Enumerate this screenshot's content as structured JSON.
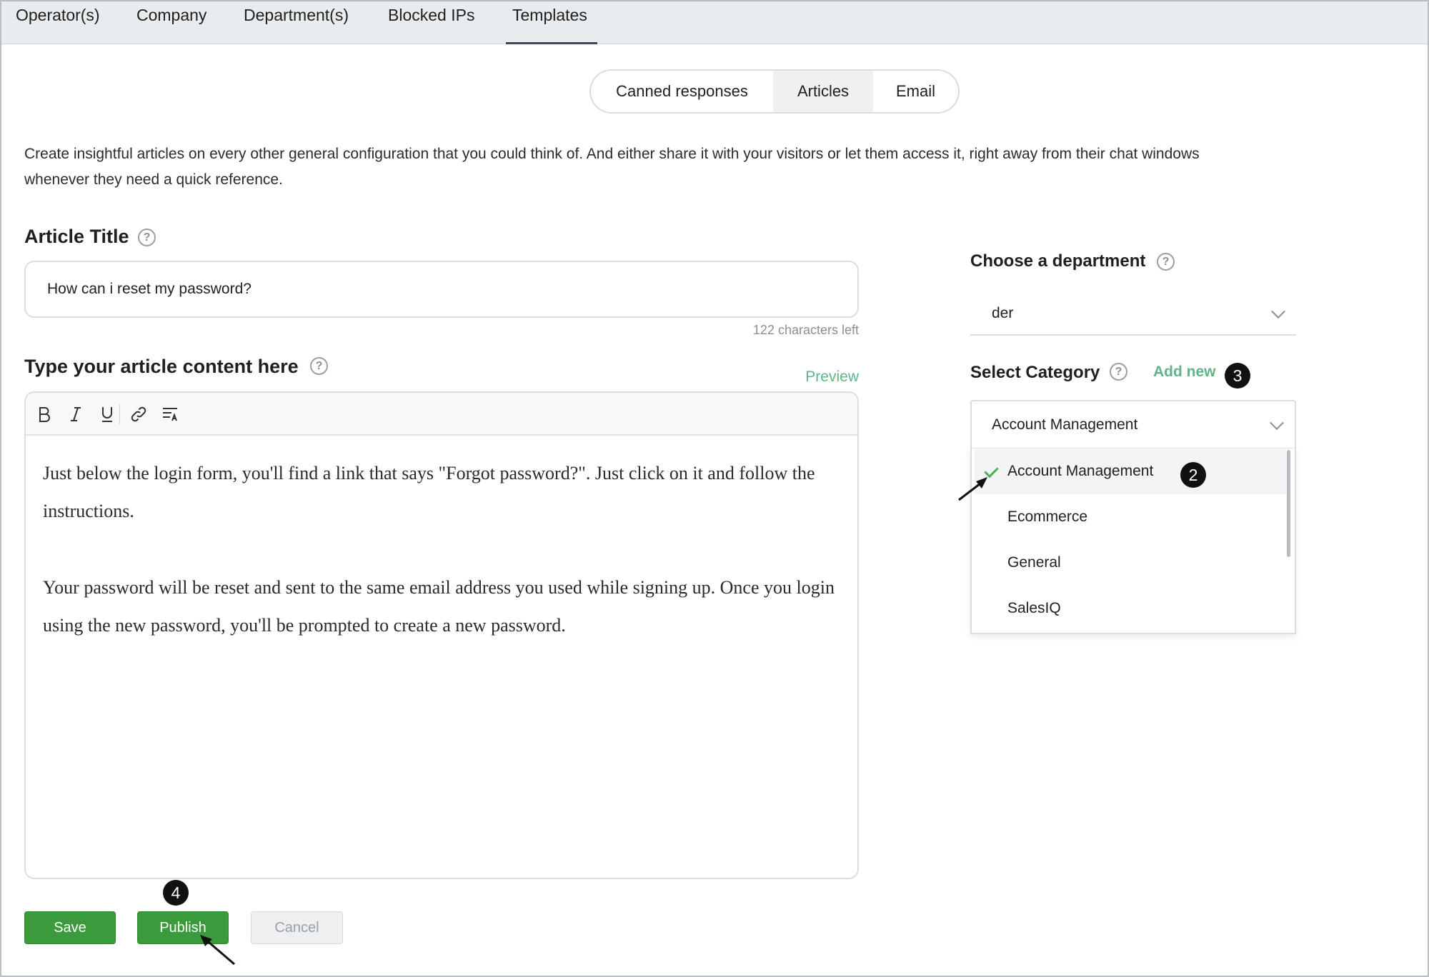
{
  "nav": {
    "tabs": [
      {
        "label": "Operator(s)"
      },
      {
        "label": "Company"
      },
      {
        "label": "Department(s)"
      },
      {
        "label": "Blocked IPs"
      },
      {
        "label": "Templates"
      }
    ],
    "active": "Templates"
  },
  "segmented": {
    "items": [
      {
        "label": "Canned responses"
      },
      {
        "label": "Articles"
      },
      {
        "label": "Email"
      }
    ],
    "active": "Articles"
  },
  "description": "Create insightful articles on every other general configuration that you could think of. And either share it with your visitors or let them access it, right away from their chat windows whenever they need a quick reference.",
  "article_title": {
    "label": "Article Title",
    "value": "How can i reset my password?",
    "chars_left": "122 characters left"
  },
  "content": {
    "label": "Type your article content here",
    "preview": "Preview",
    "toolbar": [
      "bold",
      "italic",
      "underline",
      "link",
      "format"
    ],
    "paragraphs": [
      "Just below the login form, you'll find a link that says \"Forgot password?\". Just click on it and follow the instructions.",
      "Your password will be reset and sent to the same email address you used while signing up. Once you login using the new password, you'll be prompted to create a new password."
    ]
  },
  "department": {
    "label": "Choose a department",
    "value": "der"
  },
  "category": {
    "label": "Select Category",
    "add_new": "Add new",
    "value": "Account Management",
    "options": [
      {
        "label": "Account Management",
        "selected": true
      },
      {
        "label": "Ecommerce",
        "selected": false
      },
      {
        "label": "General",
        "selected": false
      },
      {
        "label": "SalesIQ",
        "selected": false
      }
    ]
  },
  "buttons": {
    "save": "Save",
    "publish": "Publish",
    "cancel": "Cancel"
  },
  "step_badges": {
    "category_option": "2",
    "add_new": "3",
    "publish": "4"
  },
  "help_glyph": "?",
  "colors": {
    "accent_green": "#3b9a3b",
    "link_green": "#5fb585",
    "nav_bg": "#e8ecef"
  }
}
